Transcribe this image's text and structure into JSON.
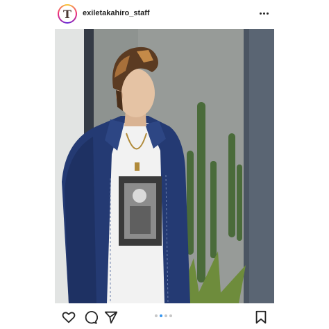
{
  "post": {
    "username": "exiletakahiro_staff",
    "avatar_letter": "T",
    "avatar_icon": "profile-avatar",
    "more_icon": "more-horizontal-icon"
  },
  "actions": {
    "like_icon": "heart-icon",
    "comment_icon": "comment-icon",
    "share_icon": "send-icon",
    "save_icon": "bookmark-icon"
  },
  "carousel": {
    "count": 4,
    "active_index": 1
  },
  "colors": {
    "text": "#262626",
    "active_dot": "#3897f0",
    "inactive_dot": "#c7c7c7"
  }
}
